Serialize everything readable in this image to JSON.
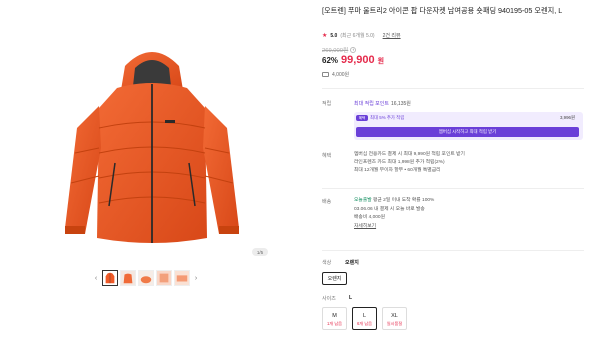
{
  "product": {
    "title": "[오트렌] 푸마 울트리2 아이콘 팝 다운자켓 남여공용 숏패딩 940195-05 오렌지, L",
    "rating_score": "5.0",
    "rating_note": "(최근 6개월 5.0)",
    "review_link": "2건 리뷰",
    "original_price": "269,000원",
    "discount_rate": "62%",
    "sale_price": "99,900",
    "currency": "원",
    "shipping_fee": "4,000원"
  },
  "gallery": {
    "counter": "1/5",
    "prev_arrow": "‹",
    "next_arrow": "›",
    "thumbnail_count": 5
  },
  "points": {
    "label": "적립",
    "line_prefix": "최대 적립 포인트",
    "line_value": "16,135원",
    "box_badge": "혜택",
    "box_text": "최대 5% 추가 적립",
    "box_value": "3,996원",
    "cta": "멤버십 시작하고 최대 적립 받기"
  },
  "benefits": {
    "label": "혜택",
    "lines": [
      "멤버십 전용카드 결제 시 최대 9,990원 적립 포인트 받기",
      "라인프렌즈 카드 최대 1,998원 추가 적립(2%)",
      "최대 12개월 무이자 할부 • 60개월 특별금리"
    ]
  },
  "delivery": {
    "label": "배송",
    "headline_green": "오늘출발",
    "headline_rest": "평균 2일 이내 도착 확률 100%",
    "line2": "03.06.06 내 결제 시 오늘 바로 발송",
    "line3": "배송비 4,000원",
    "more": "자세히보기"
  },
  "options": {
    "color_label": "색상",
    "color_value": "오렌지",
    "color_button": "오렌지",
    "size_label": "사이즈",
    "size_value": "L",
    "sizes": [
      {
        "size": "M",
        "stock": "1개 남음"
      },
      {
        "size": "L",
        "stock": "6개 남음"
      },
      {
        "size": "XL",
        "stock": "일시품절"
      }
    ]
  },
  "colors": {
    "accent": "#e52b4c",
    "purple": "#6a3fd8",
    "jacket": "#f05a28"
  }
}
